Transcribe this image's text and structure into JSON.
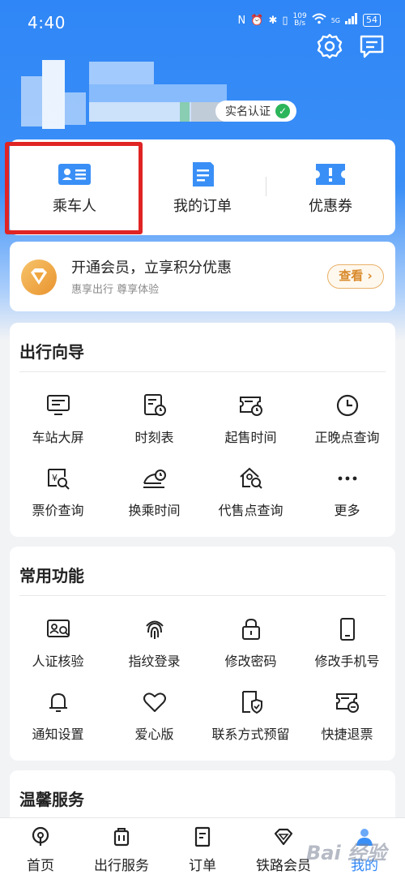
{
  "status_bar": {
    "time": "4:40",
    "net_speed": "109",
    "net_unit": "B/s",
    "signal_label": "5G",
    "battery": "54"
  },
  "header": {
    "verified_label": "实名认证",
    "icons": [
      "settings-icon",
      "message-icon"
    ]
  },
  "quick_actions": [
    {
      "label": "乘车人",
      "icon": "passenger-card-icon"
    },
    {
      "label": "我的订单",
      "icon": "order-doc-icon"
    },
    {
      "label": "优惠券",
      "icon": "coupon-icon"
    }
  ],
  "membership": {
    "title": "开通会员，立享积分优惠",
    "subtitle": "惠享出行 尊享体验",
    "button": "查看",
    "button_chevron": "›"
  },
  "travel_guide": {
    "title": "出行向导",
    "items": [
      {
        "label": "车站大屏",
        "icon": "monitor-icon"
      },
      {
        "label": "时刻表",
        "icon": "timetable-icon"
      },
      {
        "label": "起售时间",
        "icon": "ticket-clock-icon"
      },
      {
        "label": "正晚点查询",
        "icon": "clock-icon"
      },
      {
        "label": "票价查询",
        "icon": "fare-search-icon"
      },
      {
        "label": "换乘时间",
        "icon": "transfer-train-icon"
      },
      {
        "label": "代售点查询",
        "icon": "agency-search-icon"
      },
      {
        "label": "更多",
        "icon": "more-icon"
      }
    ]
  },
  "common_functions": {
    "title": "常用功能",
    "items": [
      {
        "label": "人证核验",
        "icon": "id-verify-icon"
      },
      {
        "label": "指纹登录",
        "icon": "fingerprint-icon"
      },
      {
        "label": "修改密码",
        "icon": "lock-icon"
      },
      {
        "label": "修改手机号",
        "icon": "phone-icon"
      },
      {
        "label": "通知设置",
        "icon": "bell-icon"
      },
      {
        "label": "爱心版",
        "icon": "heart-icon"
      },
      {
        "label": "联系方式预留",
        "icon": "contact-shield-icon"
      },
      {
        "label": "快捷退票",
        "icon": "quick-refund-icon"
      }
    ]
  },
  "warm_service": {
    "title": "温馨服务"
  },
  "bottom_nav": [
    {
      "label": "首页",
      "icon": "home-train-icon"
    },
    {
      "label": "出行服务",
      "icon": "luggage-icon"
    },
    {
      "label": "订单",
      "icon": "order-icon"
    },
    {
      "label": "铁路会员",
      "icon": "diamond-icon"
    },
    {
      "label": "我的",
      "icon": "profile-icon",
      "active": true
    }
  ],
  "colors": {
    "brand_blue": "#2f86f6",
    "highlight_red": "#e02424",
    "member_gold": "#e9932e",
    "verified_green": "#2cb55a"
  }
}
